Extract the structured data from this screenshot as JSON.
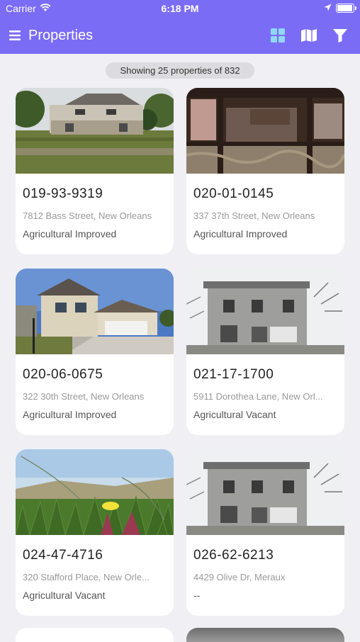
{
  "status": {
    "carrier": "Carrier",
    "time": "6:18 PM",
    "battery_level": 0.95
  },
  "nav": {
    "title": "Properties",
    "icons": [
      "menu-icon",
      "grid-view-icon",
      "map-icon",
      "filter-icon"
    ],
    "accent": "#7b6cf6"
  },
  "summary": {
    "text": "Showing 25 properties of 832"
  },
  "properties": [
    {
      "parcel_id": "019-93-9319",
      "address": "7812 Bass Street, New Orleans",
      "type": "Agricultural Improved",
      "photo": "old-house-photo"
    },
    {
      "parcel_id": "020-01-0145",
      "address": "337 37th Street, New Orleans",
      "type": "Agricultural Improved",
      "photo": "timber-building-photo"
    },
    {
      "parcel_id": "020-06-0675",
      "address": "322 30th Street, New Orleans",
      "type": "Agricultural Improved",
      "photo": "suburban-house-photo"
    },
    {
      "parcel_id": "021-17-1700",
      "address": "5911 Dorothea Lane, New Orl...",
      "type": "Agricultural Vacant",
      "photo": "concrete-building-photo"
    },
    {
      "parcel_id": "024-47-4716",
      "address": "320 Stafford Place, New Orle...",
      "type": "Agricultural Vacant",
      "photo": "dune-plants-photo"
    },
    {
      "parcel_id": "026-62-6213",
      "address": "4429 Olive Dr, Meraux",
      "type": "--",
      "photo": "concrete-building-photo"
    }
  ]
}
